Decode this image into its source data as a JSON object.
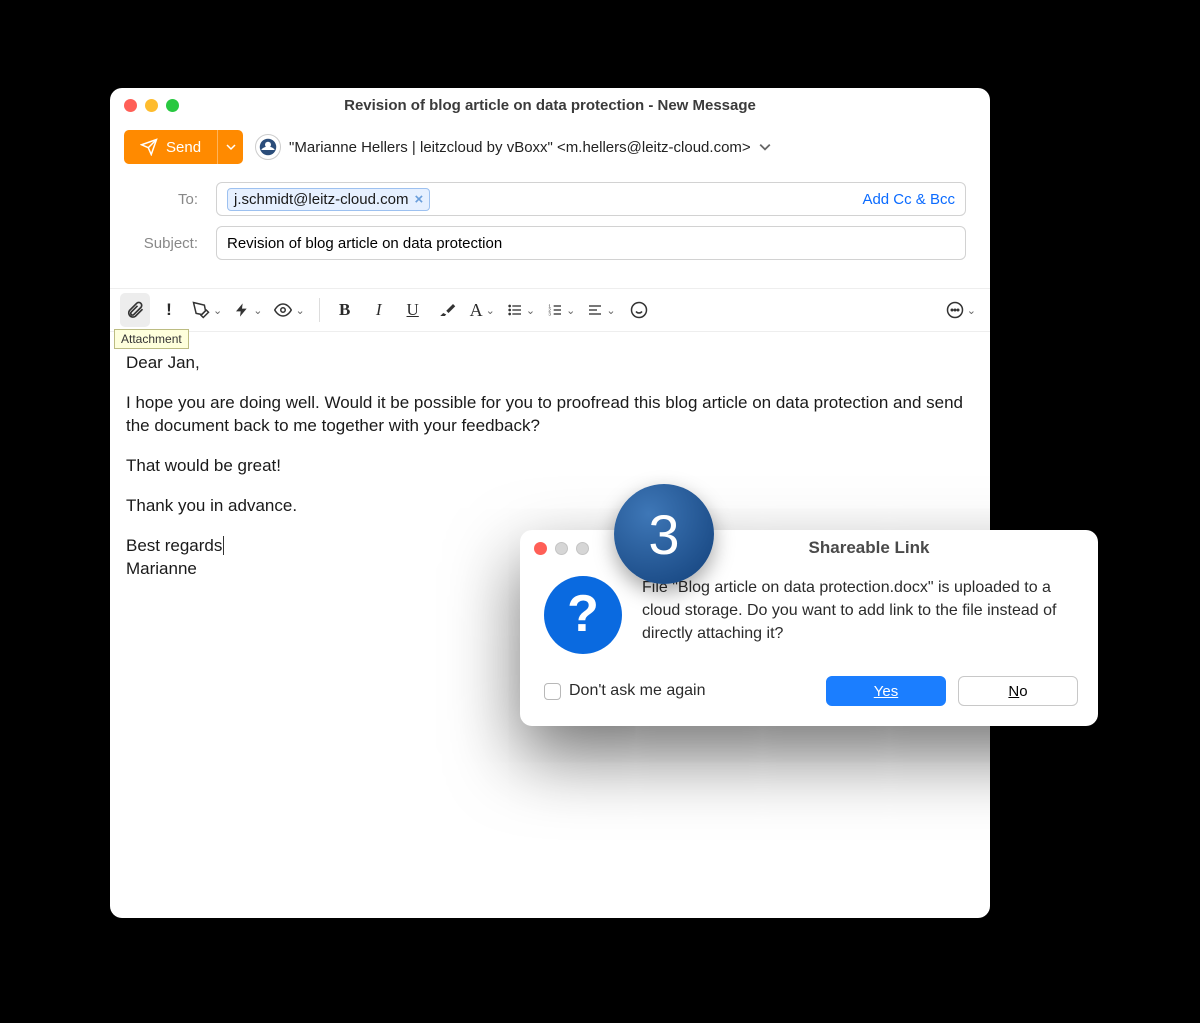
{
  "window": {
    "title": "Revision of blog article on data protection - New Message"
  },
  "send": {
    "label": "Send"
  },
  "from": {
    "display": "\"Marianne Hellers | leitzcloud by vBoxx\" <m.hellers@leitz-cloud.com>"
  },
  "fields": {
    "to_label": "To:",
    "to_chip": "j.schmidt@leitz-cloud.com",
    "cc_bcc": "Add Cc & Bcc",
    "subject_label": "Subject:",
    "subject_value": "Revision of blog article on data protection"
  },
  "toolbar": {
    "attachment_tooltip": "Attachment"
  },
  "body": {
    "p1": "Dear Jan,",
    "p2": "I hope you are doing well. Would it be possible for you to proofread this blog article on data protection and send the document back to me together with your feedback?",
    "p3": "That would be great!",
    "p4": "Thank you in advance.",
    "sig1": "Best regards",
    "sig2": "Marianne"
  },
  "step": "3",
  "dialog": {
    "title": "Shareable Link",
    "message": "File \"Blog article on data protection.docx\" is uploaded to a cloud storage. Do you want to add link to the file instead of directly attaching it?",
    "dont_ask": "Don't ask me again",
    "yes": "Yes",
    "no": "No"
  }
}
